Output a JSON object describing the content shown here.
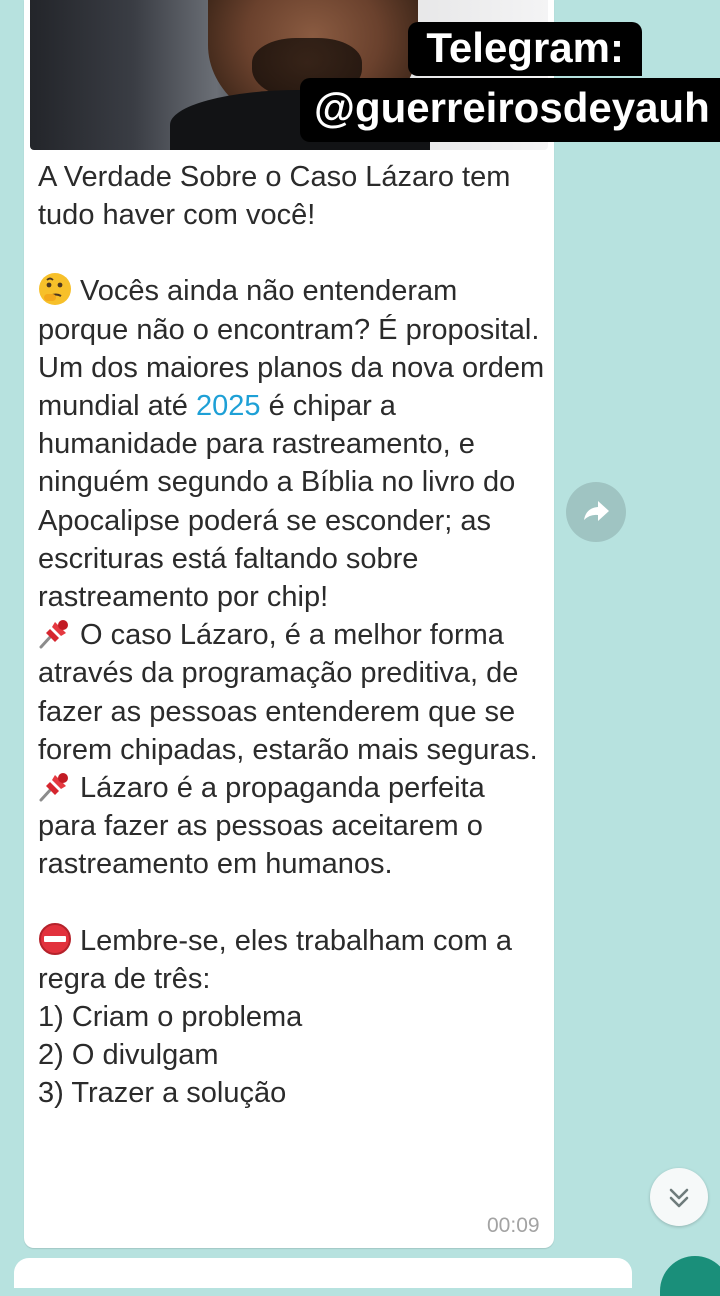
{
  "overlay": {
    "line1": "Telegram:",
    "line2": "@guerreirosdeyauh"
  },
  "message": {
    "title": "A Verdade Sobre o Caso Lázaro tem tudo haver com você!",
    "p1_emoji": "thinking-face-icon",
    "p1_line1": "Vocês ainda não entenderam",
    "p1_rest": "porque não o encontram? É proposital.",
    "p2_pre": "Um dos maiores planos da nova ordem mundial até ",
    "p2_year": "2025",
    "p2_post": " é chipar a humanidade para rastreamento, e ninguém segundo a Bíblia no livro do Apocalipse poderá se esconder; as escrituras está faltando sobre rastreamento por chip!",
    "p3_emoji": "pushpin-icon",
    "p3_line1": "O caso Lázaro, é a melhor forma",
    "p3_rest": "através da programação preditiva, de fazer as pessoas entenderem que se forem chipadas, estarão mais seguras.",
    "p4_emoji": "pushpin-icon",
    "p4_line1": "Lázaro é a propaganda perfeita",
    "p4_rest": "para fazer as pessoas aceitarem o rastreamento em humanos.",
    "p5_emoji": "no-entry-icon",
    "p5_line1": "Lembre-se, eles trabalham com a",
    "p5_rest": "regra de três:",
    "list": [
      "1) Criam o problema",
      "2) O divulgam",
      "3) Trazer a solução"
    ],
    "time": "00:09"
  },
  "icons": {
    "forward": "forward-arrow-icon",
    "scroll_down": "double-chevron-down-icon"
  },
  "colors": {
    "chat_background": "#b7e2df",
    "link": "#1ea0d6",
    "fab": "#1a8f7a"
  }
}
